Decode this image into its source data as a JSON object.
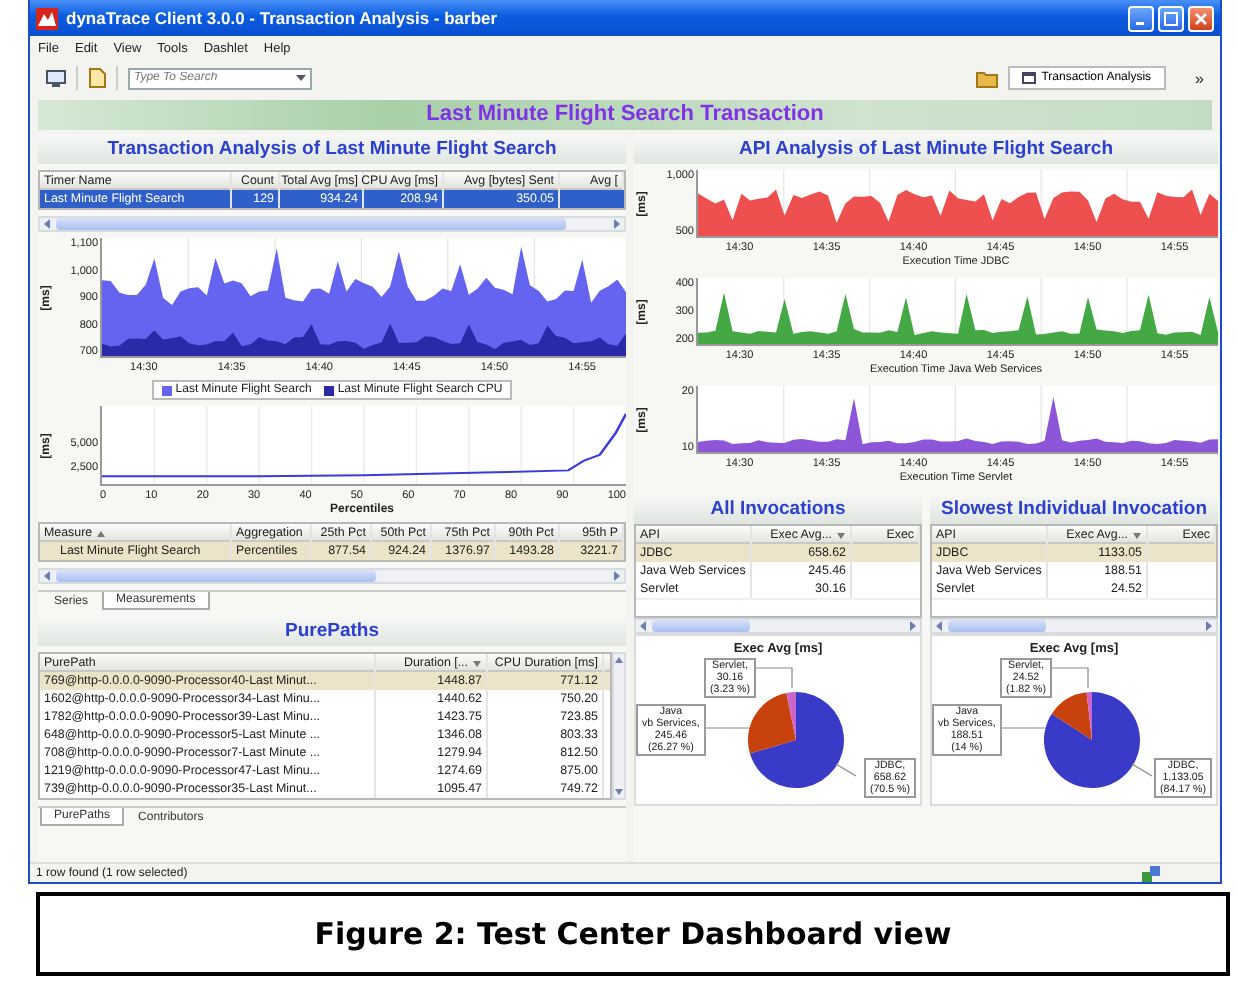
{
  "window": {
    "title": "dynaTrace Client 3.0.0 - Transaction Analysis - barber"
  },
  "menu": [
    "File",
    "Edit",
    "View",
    "Tools",
    "Dashlet",
    "Help"
  ],
  "toolbar": {
    "search": {
      "placeholder": "Type To Search"
    },
    "perspective": "Transaction Analysis",
    "overflow": "»"
  },
  "dashboard": {
    "title": "Last Minute Flight Search Transaction"
  },
  "transaction_analysis": {
    "title": "Transaction Analysis of Last Minute Flight Search",
    "table": {
      "columns": [
        "Timer Name",
        "Count",
        "Total Avg [ms]",
        "CPU Avg [ms]",
        "Avg [bytes] Sent",
        "Avg ["
      ],
      "rows": [
        {
          "cells": [
            "Last Minute Flight Search",
            "129",
            "934.24",
            "208.94",
            "350.05"
          ],
          "selected": true
        }
      ]
    },
    "response_chart": {
      "unit": "[ms]",
      "yticks": [
        "1,100",
        "1,000",
        "900",
        "800",
        "700"
      ],
      "xticks": [
        "14:30",
        "14:35",
        "14:40",
        "14:45",
        "14:50",
        "14:55"
      ],
      "legend": [
        {
          "label": "Last Minute Flight Search",
          "color": "#6464f0"
        },
        {
          "label": "Last Minute Flight Search CPU",
          "color": "#2a2aa8"
        }
      ]
    },
    "percentile_chart": {
      "unit": "[ms]",
      "yticks": [
        "5,000",
        "2,500"
      ],
      "xticks": [
        "0",
        "10",
        "20",
        "30",
        "40",
        "50",
        "60",
        "70",
        "80",
        "90",
        "100"
      ],
      "xlabel": "Percentiles"
    },
    "measures": {
      "columns": [
        "Measure",
        "Aggregation",
        "25th Pct",
        "50th Pct",
        "75th Pct",
        "90th Pct",
        "95th P"
      ],
      "rows": [
        {
          "cells": [
            "Last Minute Flight Search",
            "Percentiles",
            "877.54",
            "924.24",
            "1376.97",
            "1493.28",
            "3221.7"
          ],
          "selected": true
        }
      ]
    },
    "tabs": [
      {
        "label": "Series",
        "selected": false
      },
      {
        "label": "Measurements",
        "selected": true
      }
    ]
  },
  "purepaths": {
    "title": "PurePaths",
    "columns": [
      "PurePath",
      "Duration [...",
      "CPU Duration [ms]"
    ],
    "rows": [
      {
        "cells": [
          "769@http-0.0.0.0-9090-Processor40-Last Minut...",
          "1448.87",
          "771.12"
        ],
        "selected": true
      },
      {
        "cells": [
          "1602@http-0.0.0.0-9090-Processor34-Last Minu...",
          "1440.62",
          "750.20"
        ],
        "selected": false
      },
      {
        "cells": [
          "1782@http-0.0.0.0-9090-Processor39-Last Minu...",
          "1423.75",
          "723.85"
        ],
        "selected": false
      },
      {
        "cells": [
          "648@http-0.0.0.0-9090-Processor5-Last Minute ...",
          "1346.08",
          "803.33"
        ],
        "selected": false
      },
      {
        "cells": [
          "708@http-0.0.0.0-9090-Processor7-Last Minute ...",
          "1279.94",
          "812.50"
        ],
        "selected": false
      },
      {
        "cells": [
          "1219@http-0.0.0.0-9090-Processor47-Last Minu...",
          "1274.69",
          "875.00"
        ],
        "selected": false
      },
      {
        "cells": [
          "739@http-0.0.0.0-9090-Processor35-Last Minut...",
          "1095.47",
          "749.72"
        ],
        "selected": false
      }
    ],
    "tabs": [
      {
        "label": "PurePaths",
        "selected": true
      },
      {
        "label": "Contributors",
        "selected": false
      }
    ]
  },
  "api_analysis": {
    "title": "API Analysis of Last Minute Flight Search",
    "charts": [
      {
        "unit": "[ms]",
        "color": "#ee5050",
        "yticks": [
          "1,000",
          "500"
        ],
        "xticks": [
          "14:30",
          "14:35",
          "14:40",
          "14:45",
          "14:50",
          "14:55"
        ],
        "caption": "Execution Time JDBC"
      },
      {
        "unit": "[ms]",
        "color": "#44a844",
        "yticks": [
          "400",
          "300",
          "200"
        ],
        "xticks": [
          "14:30",
          "14:35",
          "14:40",
          "14:45",
          "14:50",
          "14:55"
        ],
        "caption": "Execution Time Java Web Services"
      },
      {
        "unit": "[ms]",
        "color": "#8d55d8",
        "yticks": [
          "20",
          "10"
        ],
        "xticks": [
          "14:30",
          "14:35",
          "14:40",
          "14:45",
          "14:50",
          "14:55"
        ],
        "caption": "Execution Time Servlet"
      }
    ]
  },
  "invocations": [
    {
      "title": "All Invocations",
      "columns": [
        "API",
        "Exec Avg...",
        "Exec"
      ],
      "rows": [
        {
          "cells": [
            "JDBC",
            "658.62"
          ],
          "selected": true
        },
        {
          "cells": [
            "Java Web Services",
            "245.46"
          ],
          "selected": false
        },
        {
          "cells": [
            "Servlet",
            "30.16"
          ],
          "selected": false
        }
      ],
      "chart_data": {
        "type": "pie",
        "title": "Exec Avg [ms]",
        "series": [
          {
            "values": [
              70.5,
              26.27,
              3.23
            ]
          }
        ],
        "value_labels": [
          "JDBC,\n658.62\n(70.5 %)",
          "Java\nvb Services,\n245.46\n(26.27 %)",
          "Servlet,\n30.16\n(3.23 %)"
        ]
      }
    },
    {
      "title": "Slowest Individual Invocation",
      "columns": [
        "API",
        "Exec Avg...",
        "Exec"
      ],
      "rows": [
        {
          "cells": [
            "JDBC",
            "1133.05"
          ],
          "selected": true
        },
        {
          "cells": [
            "Java Web Services",
            "188.51"
          ],
          "selected": false
        },
        {
          "cells": [
            "Servlet",
            "24.52"
          ],
          "selected": false
        }
      ],
      "chart_data": {
        "type": "pie",
        "title": "Exec Avg [ms]",
        "series": [
          {
            "values": [
              84.17,
              14,
              1.82
            ]
          }
        ],
        "value_labels": [
          "JDBC,\n1,133.05\n(84.17 %)",
          "Java\nvb Services,\n188.51\n(14 %)",
          "Servlet,\n24.52\n(1.82 %)"
        ]
      }
    }
  ],
  "status_bar": "1 row found (1 row selected)",
  "caption": "Figure 2: Test Center Dashboard view"
}
